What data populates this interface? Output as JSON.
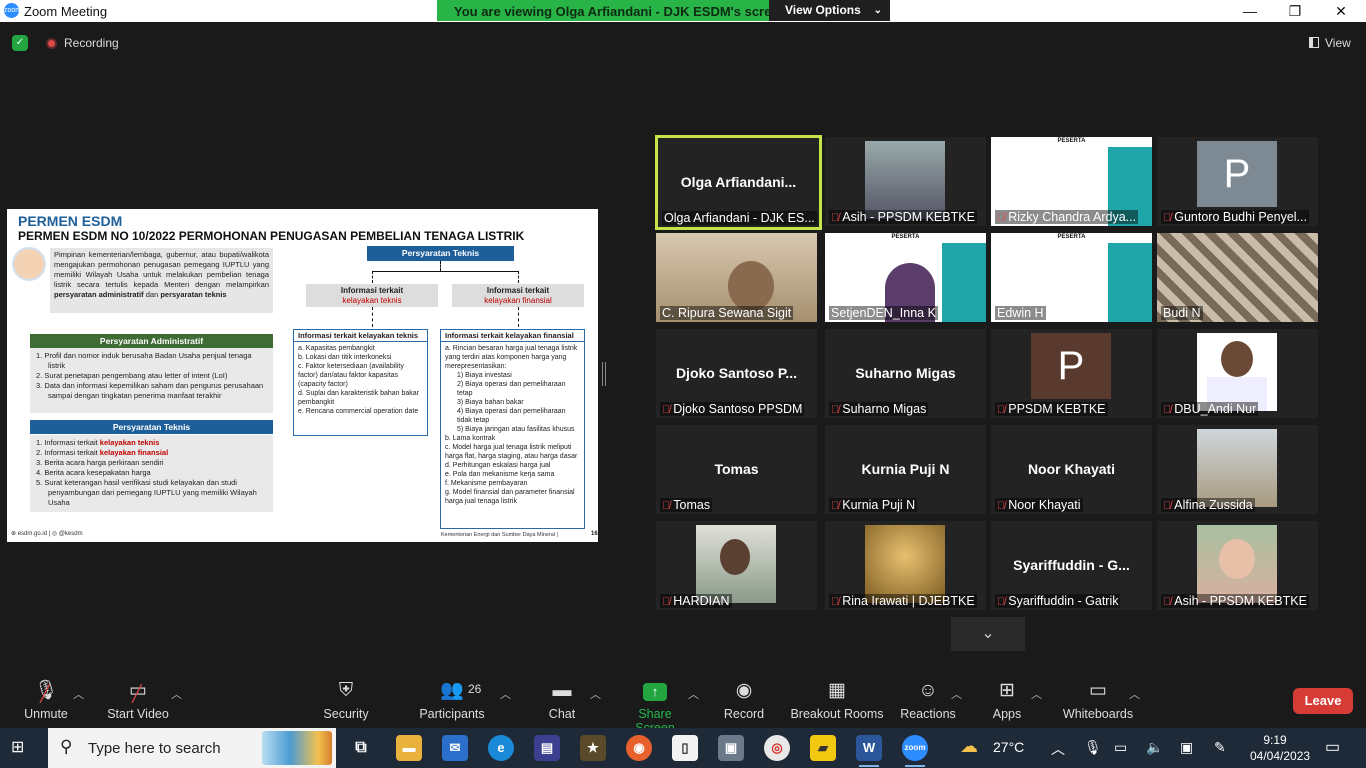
{
  "titlebar": {
    "app_icon": "zoom",
    "title": "Zoom Meeting",
    "minimize": "—",
    "restore": "❐",
    "close": "✕"
  },
  "banner": {
    "text": "You are viewing Olga Arfiandani - DJK ESDM's screen",
    "view_options": "View Options"
  },
  "status": {
    "recording_label": "Recording",
    "view_label": "View"
  },
  "slide": {
    "brand": "PERMEN ESDM",
    "title": "PERMEN ESDM NO 10/2022 PERMOHONAN PENUGASAN PEMBELIAN TENAGA LISTRIK",
    "intro_plain": "Pimpinan kementerian/lembaga, gubernur, atau bupati/walikota mengajukan permohonan penugasan pemegang IUPTLU yang memiliki Wilayah Usaha untuk melakukan pembelian tenaga listrik secara tertulis kepada Menteri dengan melampirkan ",
    "intro_bold1": "persyaratan administratif",
    "intro_and": " dan ",
    "intro_bold2": "persyaratan teknis",
    "admin_head": "Persyaratan Administratif",
    "admin_items": [
      "1. Profil dan nomor induk berusaha Badan Usaha penjual tenaga listrik",
      "2. Surat penetapan pengembang atau letter of intent (LoI)",
      "3. Data dan informasi kepemilikan saham dan pengurus perusahaan sampai dengan tingkatan penerima manfaat terakhir"
    ],
    "teknis_head": "Persyaratan Teknis",
    "teknis_items": {
      "i1a": "1. Informasi terkait ",
      "i1b": "kelayakan teknis",
      "i2a": "2. Informasi terkait ",
      "i2b": "kelayakan finansial",
      "i3": "3. Berita acara harga perkiraan sendiri",
      "i4": "4. Berita acara kesepakatan harga",
      "i5": "5. Surat keterangan hasil verifikasi studi kelayakan dan studi penyambungan dari pemegang IUPTLU yang memiliki Wilayah Usaha"
    },
    "flow_head": "Persyaratan Teknis",
    "info_teknis_1": "Informasi terkait",
    "info_teknis_2": "kelayakan teknis",
    "info_finansial_1": "Informasi terkait",
    "info_finansial_2": "kelayakan finansial",
    "teknis_box_head": "Informasi terkait kelayakan teknis",
    "teknis_box_items": [
      "a. Kapasitas pembangkit",
      "b. Lokasi dan titik interkoneksi",
      "c. Faktor ketersediaan (availability factor) dan/atau faktor kapasitas (capacity factor)",
      "d. Suplai dan karakteristik bahan bakar pembangkit",
      "e. Rencana commercial operation date"
    ],
    "finansial_box_head": "Informasi terkait kelayakan finansial",
    "finansial_box_items": [
      "a. Rincian besaran harga jual tenaga listrik yang terdiri atas komponen harga yang merepresentasikan:",
      "1) Biaya investasi",
      "2) Biaya operasi dan pemeliharaan tetap",
      "3) Biaya bahan bakar",
      "4) Biaya operasi dan pemeliharaan tidak tetap",
      "5) Biaya jaringan atau fasilitas khusus",
      "b. Lama kontrak",
      "c. Model harga jual tenaga listrik meliputi harga flat, harga staging, atau harga dasar",
      "d. Perhitungan eskalasi harga jual",
      "e. Pola dan mekanisme kerja sama",
      "f. Mekanisme pembayaran",
      "g. Model finansial dan parameter finansial harga jual tenaga listrik"
    ],
    "footer_left": "⊕ esdm.go.id  |  ◎ @kesdm",
    "footer_right": "Kementerian Energi dan Sumber Daya Mineral |",
    "page_num": "16"
  },
  "participants": [
    {
      "big": "Olga  Arfiandani...",
      "label": "Olga Arfiandani - DJK ES...",
      "muted": false,
      "active": true,
      "kind": "name"
    },
    {
      "big": "",
      "label": "Asih - PPSDM KEBTKE",
      "muted": true,
      "active": false,
      "kind": "photo-building"
    },
    {
      "big": "",
      "label": "Rizky Chandra Ardya...",
      "muted": true,
      "active": false,
      "kind": "peserta"
    },
    {
      "big": "P",
      "label": "Guntoro Budhi Penyel...",
      "muted": true,
      "active": false,
      "kind": "pgrey"
    },
    {
      "big": "",
      "label": "C. Ripura Sewana Sigit",
      "muted": false,
      "active": false,
      "kind": "video-man"
    },
    {
      "big": "",
      "label": "SetjenDEN_Inna K",
      "muted": false,
      "active": false,
      "kind": "peserta-woman"
    },
    {
      "big": "",
      "label": "Edwin H",
      "muted": false,
      "active": false,
      "kind": "peserta"
    },
    {
      "big": "",
      "label": "Budi N",
      "muted": false,
      "active": false,
      "kind": "video-shirt"
    },
    {
      "big": "Djoko Santoso P...",
      "label": "Djoko Santoso PPSDM",
      "muted": true,
      "active": false,
      "kind": "name"
    },
    {
      "big": "Suharno Migas",
      "label": "Suharno Migas",
      "muted": true,
      "active": false,
      "kind": "name"
    },
    {
      "big": "P",
      "label": "PPSDM KEBTKE",
      "muted": true,
      "active": false,
      "kind": "pbrown"
    },
    {
      "big": "",
      "label": "DBU_Andi Nur",
      "muted": true,
      "active": false,
      "kind": "photo-man"
    },
    {
      "big": "Tomas",
      "label": "Tomas",
      "muted": true,
      "active": false,
      "kind": "name"
    },
    {
      "big": "Kurnia Puji N",
      "label": "Kurnia Puji N",
      "muted": true,
      "active": false,
      "kind": "name"
    },
    {
      "big": "Noor Khayati",
      "label": "Noor Khayati",
      "muted": true,
      "active": false,
      "kind": "name"
    },
    {
      "big": "",
      "label": "Alfina Zussida",
      "muted": true,
      "active": false,
      "kind": "photo-gazebo"
    },
    {
      "big": "",
      "label": "HARDIAN",
      "muted": true,
      "active": false,
      "kind": "photo-hardian"
    },
    {
      "big": "",
      "label": "Rina Irawati | DJEBTKE",
      "muted": true,
      "active": false,
      "kind": "photo-gold"
    },
    {
      "big": "Syariffuddin  - G...",
      "label": "Syariffuddin - Gatrik",
      "muted": true,
      "active": false,
      "kind": "name"
    },
    {
      "big": "",
      "label": "Asih - PPSDM KEBTKE",
      "muted": true,
      "active": false,
      "kind": "photo-hijab"
    }
  ],
  "peserta_text": "PESERTA",
  "toolbar": {
    "unmute": "Unmute",
    "start_video": "Start Video",
    "security": "Security",
    "participants": "Participants",
    "participants_count": "26",
    "chat": "Chat",
    "share_screen": "Share Screen",
    "record": "Record",
    "breakout": "Breakout Rooms",
    "reactions": "Reactions",
    "apps": "Apps",
    "whiteboards": "Whiteboards",
    "leave": "Leave"
  },
  "taskbar": {
    "search_placeholder": "Type here to search",
    "temperature": "27°C",
    "time": "9:19",
    "date": "04/04/2023"
  }
}
